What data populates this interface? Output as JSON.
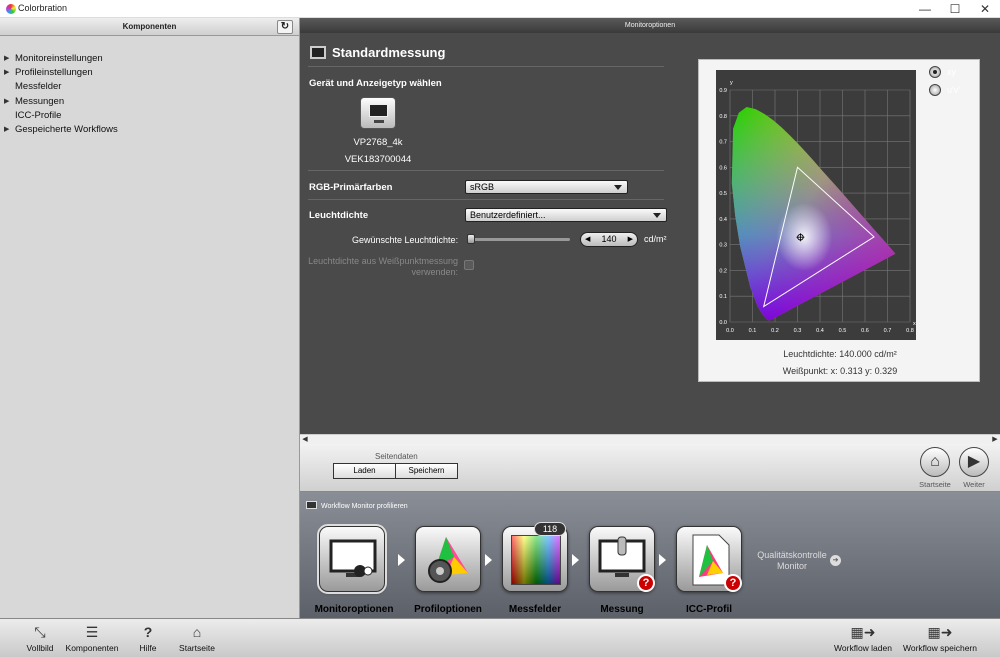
{
  "window": {
    "title": "Colorbration",
    "minimize": "—",
    "maximize": "☐",
    "close": "✕"
  },
  "left_panel": {
    "header": "Komponenten",
    "refresh_icon": "↻",
    "items": [
      {
        "label": "Monitoreinstellungen",
        "expandable": true
      },
      {
        "label": "Profileinstellungen",
        "expandable": true
      },
      {
        "label": "Messfelder",
        "expandable": false
      },
      {
        "label": "Messungen",
        "expandable": true
      },
      {
        "label": "ICC-Profile",
        "expandable": false
      },
      {
        "label": "Gespeicherte Workflows",
        "expandable": true
      }
    ]
  },
  "main": {
    "header": "Monitoroptionen",
    "section_title": "Standardmessung",
    "device_heading": "Gerät und Anzeigetyp wählen",
    "device_name": "VP2768_4k",
    "device_serial": "VEK183700044",
    "rgb_label": "RGB-Primärfarben",
    "rgb_value": "sRGB",
    "luminance_label": "Leuchtdichte",
    "luminance_value": "Benutzerdefiniert...",
    "desired_luminance_label": "Gewünschte Leuchtdichte:",
    "desired_luminance_value": "140",
    "desired_luminance_fraction": 0.0,
    "luminance_unit": "cd/m²",
    "whitepoint_option_label": "Leuchtdichte aus Weißpunktmessung verwenden:"
  },
  "chart": {
    "radio_xy": "xy",
    "radio_uv": "u'v'",
    "selected": "xy",
    "axis_y_label": "y",
    "axis_x_label": "x",
    "x_ticks": [
      "0.0",
      "0.1",
      "0.2",
      "0.3",
      "0.4",
      "0.5",
      "0.6",
      "0.7",
      "0.8"
    ],
    "y_ticks": [
      "0.9",
      "0.8",
      "0.7",
      "0.6",
      "0.5",
      "0.4",
      "0.3",
      "0.2",
      "0.1",
      "0.0"
    ],
    "luminance_text": "Leuchtdichte: 140.000 cd/m²",
    "whitepoint_text": "Weißpunkt: x: 0.313  y: 0.329"
  },
  "chart_data": {
    "type": "scatter",
    "xlim": [
      0,
      0.8
    ],
    "ylim": [
      0,
      0.9
    ],
    "gamut_triangle": [
      [
        0.64,
        0.33
      ],
      [
        0.3,
        0.6
      ],
      [
        0.15,
        0.06
      ]
    ],
    "white_point": [
      0.313,
      0.329
    ],
    "xlabel": "x",
    "ylabel": "y"
  },
  "page_bar": {
    "section_label": "Seitendaten",
    "load_label": "Laden",
    "save_label": "Speichern",
    "home_label": "Startseite",
    "next_label": "Weiter"
  },
  "workflow": {
    "title": "Workflow Monitor profilieren",
    "steps": [
      {
        "label": "Monitoroptionen"
      },
      {
        "label": "Profiloptionen"
      },
      {
        "label": "Messfelder",
        "count": "118"
      },
      {
        "label": "Messung",
        "badge": "?"
      },
      {
        "label": "ICC-Profil",
        "badge": "?"
      }
    ],
    "quality_check": "Qualitätskontrolle Monitor"
  },
  "toolbar": {
    "fullscreen": "Vollbild",
    "components": "Komponenten",
    "help": "Hilfe",
    "home": "Startseite",
    "load_workflow": "Workflow laden",
    "save_workflow": "Workflow speichern"
  }
}
